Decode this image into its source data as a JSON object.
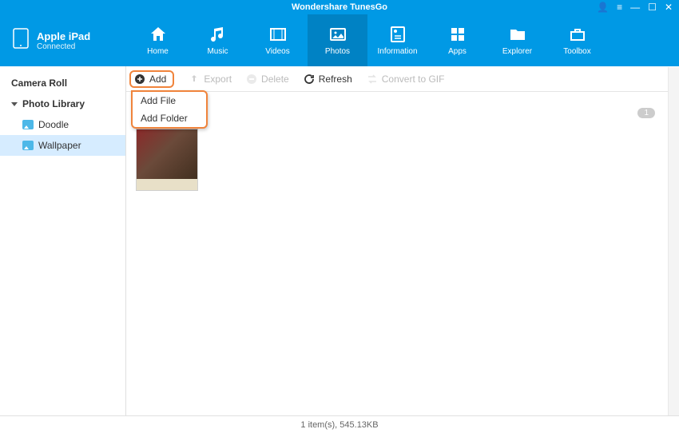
{
  "app": {
    "title": "Wondershare TunesGo"
  },
  "device": {
    "name": "Apple iPad",
    "status": "Connected"
  },
  "nav": [
    {
      "label": "Home"
    },
    {
      "label": "Music"
    },
    {
      "label": "Videos"
    },
    {
      "label": "Photos"
    },
    {
      "label": "Information"
    },
    {
      "label": "Apps"
    },
    {
      "label": "Explorer"
    },
    {
      "label": "Toolbox"
    }
  ],
  "sidebar": {
    "cameraRoll": "Camera Roll",
    "photoLibrary": "Photo Library",
    "items": [
      {
        "label": "Doodle"
      },
      {
        "label": "Wallpaper"
      }
    ]
  },
  "toolbar": {
    "add": "Add",
    "export": "Export",
    "delete": "Delete",
    "refresh": "Refresh",
    "convert": "Convert to GIF"
  },
  "dropdown": {
    "addFile": "Add File",
    "addFolder": "Add Folder"
  },
  "badge": "1",
  "status": "1 item(s), 545.13KB"
}
